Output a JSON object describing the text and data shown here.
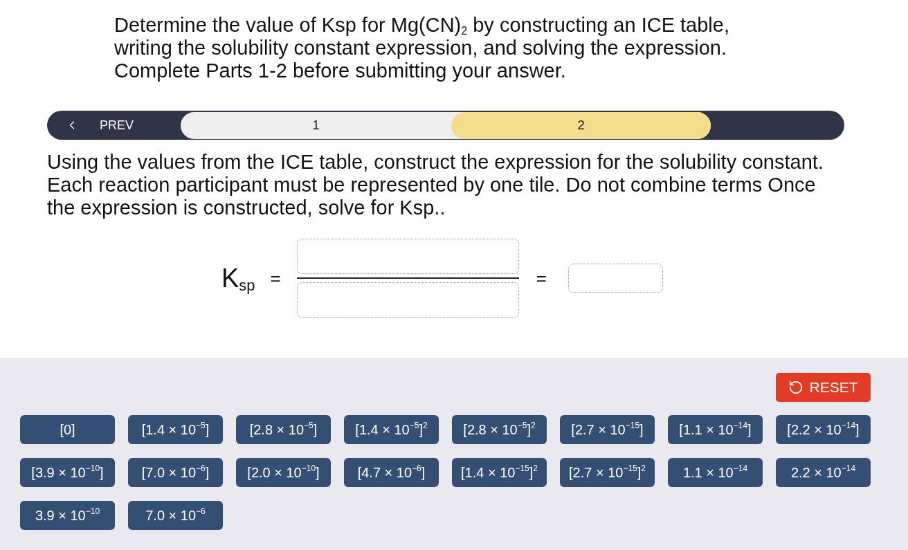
{
  "intro": "Determine the value of Ksp for Mg(CN)$_{2}$ by constructing an ICE table, writing the solubility constant expression, and solving the expression. Complete Parts 1-2 before submitting your answer.",
  "step_nav": {
    "prev": "PREV",
    "steps": [
      {
        "label": "1",
        "selected": false
      },
      {
        "label": "2",
        "selected": true
      }
    ]
  },
  "instructions": "Using the values from the ICE table, construct the expression for the solubility constant. Each reaction participant must be represented by one tile. Do not combine terms Once the expression is constructed, solve for Ksp..",
  "equation": {
    "symbol": "K$_{sp}$",
    "equals": [
      "=",
      "="
    ]
  },
  "tile_bank": {
    "reset": "RESET",
    "tiles": [
      "[0]",
      "[1.4 × 10$^{−5}$]",
      "[2.8 × 10$^{−5}$]",
      "[1.4 × 10$^{−5}$]$^{2}$",
      "[2.8 × 10$^{−5}$]$^{2}$",
      "[2.7 × 10$^{−15}$]",
      "[1.1 × 10$^{−14}$]",
      "[2.2 × 10$^{−14}$]",
      "[3.9 × 10$^{−10}$]",
      "[7.0 × 10$^{−6}$]",
      "[2.0 × 10$^{−10}$]",
      "[4.7 × 10$^{−6}$]",
      "[1.4 × 10$^{−15}$]$^{2}$",
      "[2.7 × 10$^{−15}$]$^{2}$",
      "1.1 × 10$^{−14}$",
      "2.2 × 10$^{−14}$",
      "3.9 × 10$^{−10}$",
      "7.0 × 10$^{−6}$"
    ]
  }
}
